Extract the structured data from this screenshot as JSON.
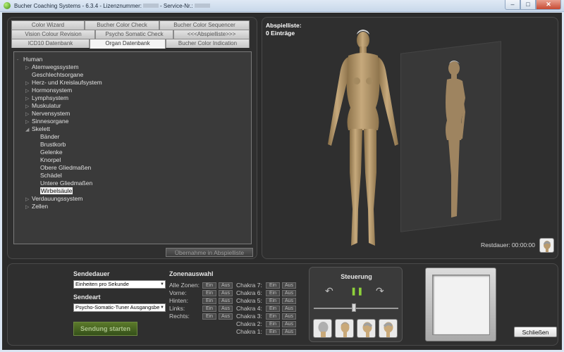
{
  "window": {
    "app_name": "Bucher Coaching Systems",
    "version": "6.3.4",
    "license_label": "Lizenznummer:",
    "service_label": "Service-Nr.:",
    "minimize": "–",
    "maximize": "□",
    "close": "✕"
  },
  "tabs": {
    "row1": [
      "Color Wizard",
      "Bucher Color Check",
      "Bucher Color Sequencer"
    ],
    "row2": [
      "Vision Colour Revision",
      "Psycho Somatic Check",
      "<<<Abspielliste>>>"
    ],
    "row3": [
      "ICD10 Datenbank",
      "Organ Datenbank",
      "Bucher Color Indication"
    ],
    "active": "Organ Datenbank"
  },
  "tree": {
    "root": "Human",
    "items": [
      {
        "label": "Atemwegssystem",
        "toggle": "▷"
      },
      {
        "label": "Geschlechtsorgane",
        "toggle": ""
      },
      {
        "label": "Herz- und Kreislaufsystem",
        "toggle": "▷"
      },
      {
        "label": "Hormonsystem",
        "toggle": "▷"
      },
      {
        "label": "Lymphsystem",
        "toggle": "▷"
      },
      {
        "label": "Muskulatur",
        "toggle": "▷"
      },
      {
        "label": "Nervensystem",
        "toggle": "▷"
      },
      {
        "label": "Sinnesorgane",
        "toggle": "▷"
      },
      {
        "label": "Skelett",
        "toggle": "◢"
      },
      {
        "label": "Bänder",
        "toggle": ""
      },
      {
        "label": "Brustkorb",
        "toggle": ""
      },
      {
        "label": "Gelenke",
        "toggle": ""
      },
      {
        "label": "Knorpel",
        "toggle": ""
      },
      {
        "label": "Obere Gliedmaßen",
        "toggle": ""
      },
      {
        "label": "Schädel",
        "toggle": ""
      },
      {
        "label": "Untere Gliedmaßen",
        "toggle": ""
      },
      {
        "label": "Wirbelsäule",
        "toggle": ""
      },
      {
        "label": "Verdauungssystem",
        "toggle": "▷"
      },
      {
        "label": "Zellen",
        "toggle": "▷"
      }
    ],
    "selected": "Wirbelsäule",
    "adopt_button": "Übernahme in Abspielliste"
  },
  "playlist": {
    "title": "Abspielliste:",
    "count": "0 Einträge",
    "rest_label": "Restdauer:",
    "rest_value": "00:00:00"
  },
  "send": {
    "duration_label": "Sendedauer",
    "duration_value": "Einheiten pro Sekunde",
    "type_label": "Sendeart",
    "type_value": "Psycho-Somatic-Tuner Ausgangsbe",
    "start_button": "Sendung starten"
  },
  "zones": {
    "title": "Zonenauswahl",
    "on": "Ein",
    "off": "Aus",
    "left_labels": [
      "Alle Zonen:",
      "Vorne:",
      "Hinten:",
      "Links:",
      "Rechts:"
    ],
    "chakras": [
      "Chakra 7:",
      "Chakra 6:",
      "Chakra 5:",
      "Chakra 4:",
      "Chakra 3:",
      "Chakra 2:",
      "Chakra 1:"
    ]
  },
  "control": {
    "title": "Steuerung",
    "rotate_left": "↶",
    "pause": "❚❚",
    "rotate_right": "↷",
    "slider_value": 0.5
  },
  "footer": {
    "close_button": "Schließen"
  },
  "colors": {
    "skin": "#b89a6e",
    "accent_green": "#3d8a12",
    "panel_bg": "#2f2f2f"
  }
}
